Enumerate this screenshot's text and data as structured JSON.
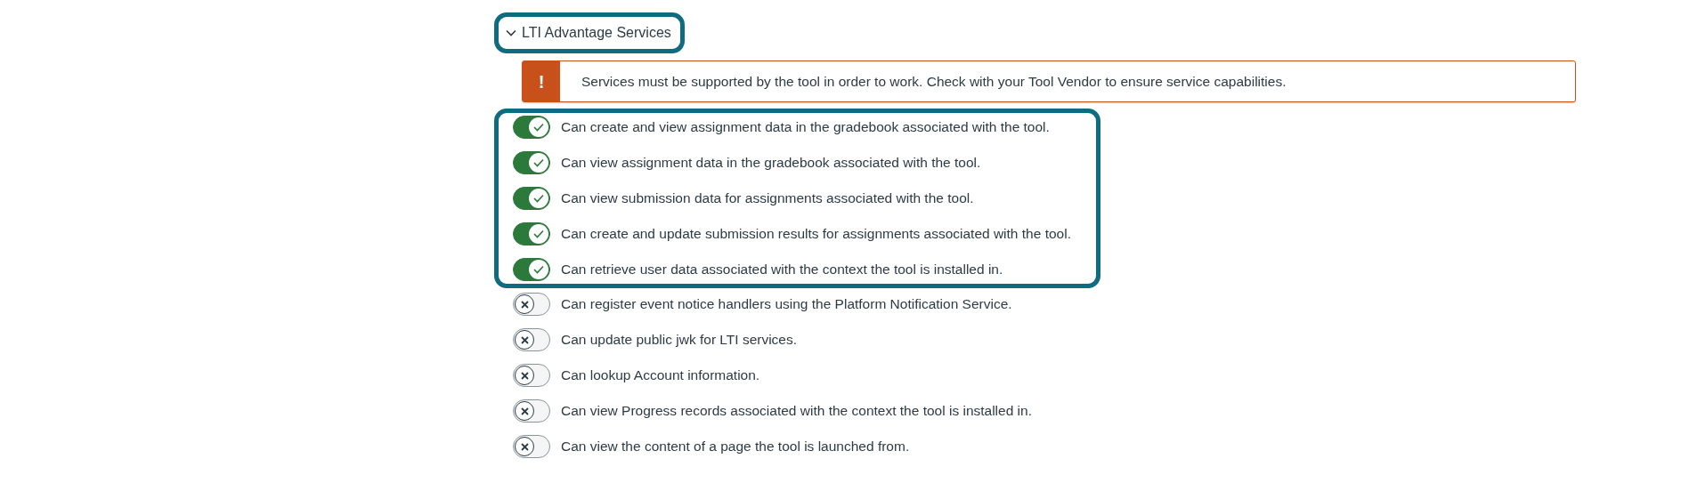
{
  "section": {
    "label": "LTI Advantage Services",
    "expanded": true,
    "highlighted": true
  },
  "alert": {
    "kind": "warning",
    "icon": "!",
    "message": "Services must be supported by the tool in order to work. Check with your Tool Vendor to ensure service capabilities."
  },
  "service_groups": [
    {
      "highlighted": true,
      "services": [
        {
          "label": "Can create and view assignment data in the gradebook associated with the tool.",
          "on": true
        },
        {
          "label": "Can view assignment data in the gradebook associated with the tool.",
          "on": true
        },
        {
          "label": "Can view submission data for assignments associated with the tool.",
          "on": true
        },
        {
          "label": "Can create and update submission results for assignments associated with the tool.",
          "on": true
        },
        {
          "label": "Can retrieve user data associated with the context the tool is installed in.",
          "on": true
        }
      ]
    },
    {
      "highlighted": false,
      "services": [
        {
          "label": "Can register event notice handlers using the Platform Notification Service.",
          "on": false
        },
        {
          "label": "Can update public jwk for LTI services.",
          "on": false
        },
        {
          "label": "Can lookup Account information.",
          "on": false
        },
        {
          "label": "Can view Progress records associated with the context the tool is installed in.",
          "on": false
        },
        {
          "label": "Can view the content of a page the tool is launched from.",
          "on": false
        }
      ]
    }
  ]
}
